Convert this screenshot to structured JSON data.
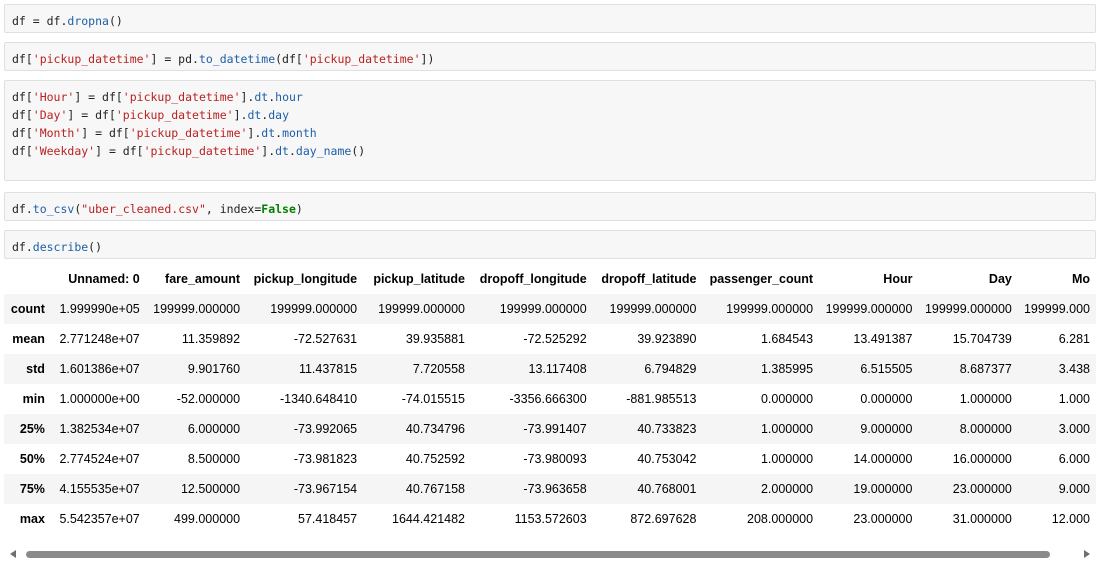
{
  "cells": [
    {
      "lines": [
        [
          {
            "t": "df = df.",
            "c": ""
          },
          {
            "t": "dropna",
            "c": "m"
          },
          {
            "t": "()",
            "c": ""
          }
        ]
      ]
    },
    {
      "lines": [
        [
          {
            "t": "df[",
            "c": ""
          },
          {
            "t": "'pickup_datetime'",
            "c": "s"
          },
          {
            "t": "] = pd.",
            "c": ""
          },
          {
            "t": "to_datetime",
            "c": "m"
          },
          {
            "t": "(df[",
            "c": ""
          },
          {
            "t": "'pickup_datetime'",
            "c": "s"
          },
          {
            "t": "])",
            "c": ""
          }
        ]
      ]
    },
    {
      "lines": [
        [
          {
            "t": "df[",
            "c": ""
          },
          {
            "t": "'Hour'",
            "c": "s"
          },
          {
            "t": "] = df[",
            "c": ""
          },
          {
            "t": "'pickup_datetime'",
            "c": "s"
          },
          {
            "t": "].",
            "c": ""
          },
          {
            "t": "dt",
            "c": "m"
          },
          {
            "t": ".",
            "c": ""
          },
          {
            "t": "hour",
            "c": "m"
          }
        ],
        [
          {
            "t": "df[",
            "c": ""
          },
          {
            "t": "'Day'",
            "c": "s"
          },
          {
            "t": "] = df[",
            "c": ""
          },
          {
            "t": "'pickup_datetime'",
            "c": "s"
          },
          {
            "t": "].",
            "c": ""
          },
          {
            "t": "dt",
            "c": "m"
          },
          {
            "t": ".",
            "c": ""
          },
          {
            "t": "day",
            "c": "m"
          }
        ],
        [
          {
            "t": "df[",
            "c": ""
          },
          {
            "t": "'Month'",
            "c": "s"
          },
          {
            "t": "] = df[",
            "c": ""
          },
          {
            "t": "'pickup_datetime'",
            "c": "s"
          },
          {
            "t": "].",
            "c": ""
          },
          {
            "t": "dt",
            "c": "m"
          },
          {
            "t": ".",
            "c": ""
          },
          {
            "t": "month",
            "c": "m"
          }
        ],
        [
          {
            "t": "df[",
            "c": ""
          },
          {
            "t": "'Weekday'",
            "c": "s"
          },
          {
            "t": "] = df[",
            "c": ""
          },
          {
            "t": "'pickup_datetime'",
            "c": "s"
          },
          {
            "t": "].",
            "c": ""
          },
          {
            "t": "dt",
            "c": "m"
          },
          {
            "t": ".",
            "c": ""
          },
          {
            "t": "day_name",
            "c": "m"
          },
          {
            "t": "()",
            "c": ""
          }
        ]
      ]
    },
    {
      "lines": [
        [
          {
            "t": "df.",
            "c": ""
          },
          {
            "t": "to_csv",
            "c": "m"
          },
          {
            "t": "(",
            "c": ""
          },
          {
            "t": "\"uber_cleaned.csv\"",
            "c": "s"
          },
          {
            "t": ", index=",
            "c": ""
          },
          {
            "t": "False",
            "c": "k"
          },
          {
            "t": ")",
            "c": ""
          }
        ]
      ]
    },
    {
      "lines": [
        [
          {
            "t": "df.",
            "c": ""
          },
          {
            "t": "describe",
            "c": "m"
          },
          {
            "t": "()",
            "c": ""
          }
        ]
      ]
    }
  ],
  "table": {
    "columns": [
      "",
      "Unnamed: 0",
      "fare_amount",
      "pickup_longitude",
      "pickup_latitude",
      "dropoff_longitude",
      "dropoff_latitude",
      "passenger_count",
      "Hour",
      "Day",
      "Mo"
    ],
    "rows": [
      [
        "count",
        "1.999990e+05",
        "199999.000000",
        "199999.000000",
        "199999.000000",
        "199999.000000",
        "199999.000000",
        "199999.000000",
        "199999.000000",
        "199999.000000",
        "199999.000"
      ],
      [
        "mean",
        "2.771248e+07",
        "11.359892",
        "-72.527631",
        "39.935881",
        "-72.525292",
        "39.923890",
        "1.684543",
        "13.491387",
        "15.704739",
        "6.281"
      ],
      [
        "std",
        "1.601386e+07",
        "9.901760",
        "11.437815",
        "7.720558",
        "13.117408",
        "6.794829",
        "1.385995",
        "6.515505",
        "8.687377",
        "3.438"
      ],
      [
        "min",
        "1.000000e+00",
        "-52.000000",
        "-1340.648410",
        "-74.015515",
        "-3356.666300",
        "-881.985513",
        "0.000000",
        "0.000000",
        "1.000000",
        "1.000"
      ],
      [
        "25%",
        "1.382534e+07",
        "6.000000",
        "-73.992065",
        "40.734796",
        "-73.991407",
        "40.733823",
        "1.000000",
        "9.000000",
        "8.000000",
        "3.000"
      ],
      [
        "50%",
        "2.774524e+07",
        "8.500000",
        "-73.981823",
        "40.752592",
        "-73.980093",
        "40.753042",
        "1.000000",
        "14.000000",
        "16.000000",
        "6.000"
      ],
      [
        "75%",
        "4.155535e+07",
        "12.500000",
        "-73.967154",
        "40.767158",
        "-73.963658",
        "40.768001",
        "2.000000",
        "19.000000",
        "23.000000",
        "9.000"
      ],
      [
        "max",
        "5.542357e+07",
        "499.000000",
        "57.418457",
        "1644.421482",
        "1153.572603",
        "872.697628",
        "208.000000",
        "23.000000",
        "31.000000",
        "12.000"
      ]
    ]
  },
  "colors": {
    "string": "#ba2121",
    "method": "#1f5fa8",
    "keyword": "#008000",
    "cell_bg": "#f7f7f7"
  }
}
